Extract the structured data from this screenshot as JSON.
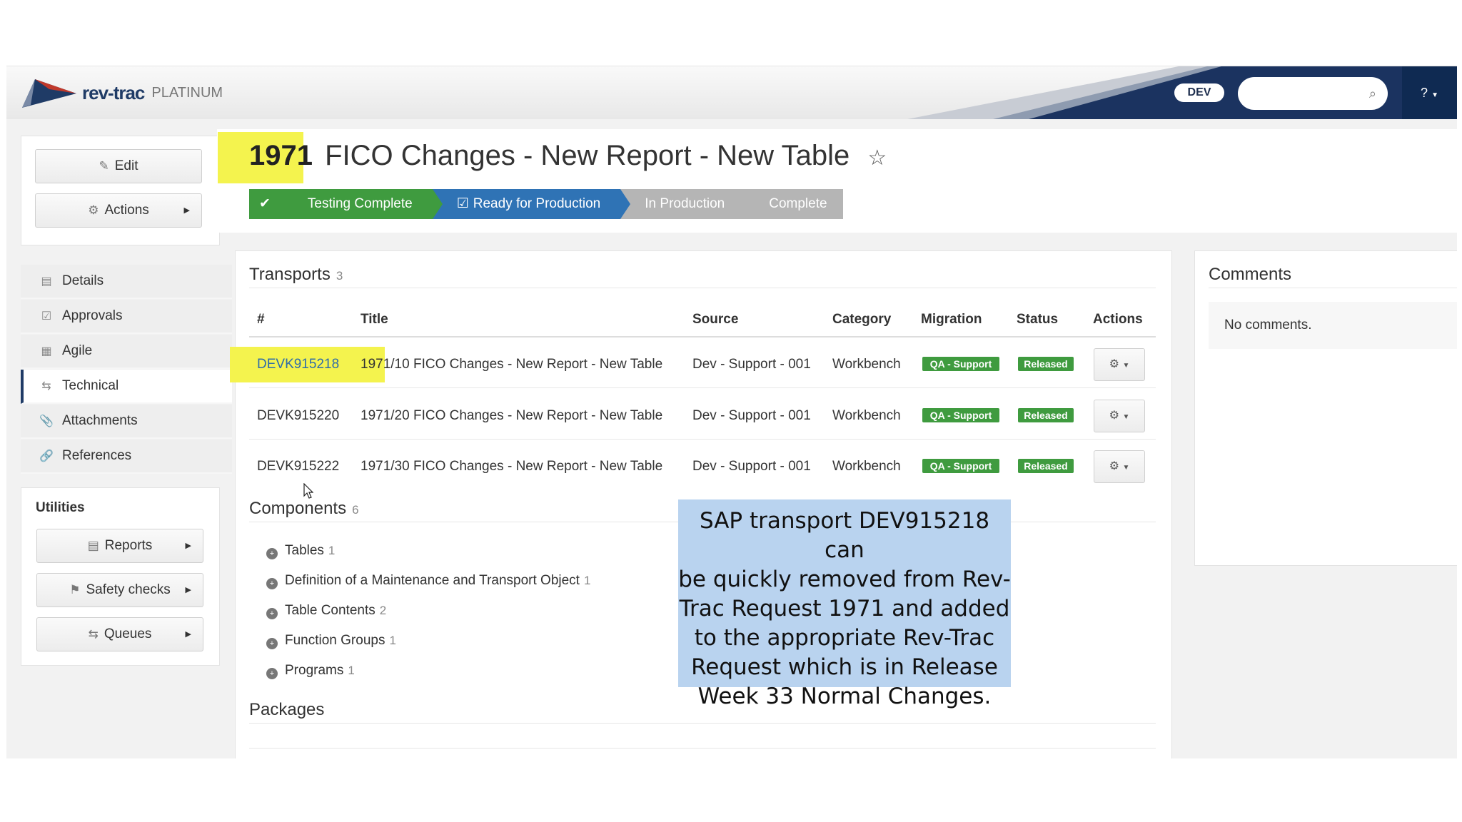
{
  "header": {
    "brand": "rev-trac",
    "tier": "PLATINUM",
    "env_badge": "DEV",
    "search_placeholder": "",
    "help_label": "?"
  },
  "left_actions": {
    "edit_label": "Edit",
    "actions_label": "Actions"
  },
  "nav": {
    "items": [
      {
        "label": "Details",
        "icon": "list-icon"
      },
      {
        "label": "Approvals",
        "icon": "check-square-icon"
      },
      {
        "label": "Agile",
        "icon": "grid-icon"
      },
      {
        "label": "Technical",
        "icon": "exchange-icon",
        "active": true
      },
      {
        "label": "Attachments",
        "icon": "paperclip-icon"
      },
      {
        "label": "References",
        "icon": "link-icon"
      }
    ]
  },
  "utilities": {
    "title": "Utilities",
    "reports_label": "Reports",
    "safety_label": "Safety checks",
    "queues_label": "Queues"
  },
  "request": {
    "number": "1971",
    "title": "FICO Changes - New Report - New Table",
    "steps": [
      {
        "label": "",
        "icon": "check-icon",
        "color": "#3f9b3f"
      },
      {
        "label": "Testing Complete",
        "color": "#3f9b3f"
      },
      {
        "label": "Ready for Production",
        "icon": "check-square-icon",
        "color": "#2f73b5"
      },
      {
        "label": "In Production",
        "color": "#b5b5b5"
      },
      {
        "label": "Complete",
        "color": "#b5b5b5"
      }
    ]
  },
  "transports": {
    "heading": "Transports",
    "count": "3",
    "columns": [
      "#",
      "Title",
      "Source",
      "Category",
      "Migration",
      "Status",
      "Actions"
    ],
    "rows": [
      {
        "id": "DEVK915218",
        "title": "1971/10 FICO Changes - New Report - New Table",
        "source": "Dev - Support - 001",
        "category": "Workbench",
        "migration": "QA - Support",
        "status": "Released"
      },
      {
        "id": "DEVK915220",
        "title": "1971/20 FICO Changes - New Report - New Table",
        "source": "Dev - Support - 001",
        "category": "Workbench",
        "migration": "QA - Support",
        "status": "Released"
      },
      {
        "id": "DEVK915222",
        "title": "1971/30 FICO Changes - New Report - New Table",
        "source": "Dev - Support - 001",
        "category": "Workbench",
        "migration": "QA - Support",
        "status": "Released"
      }
    ]
  },
  "components": {
    "heading": "Components",
    "count": "6",
    "items": [
      {
        "label": "Tables",
        "count": "1"
      },
      {
        "label": "Definition of a Maintenance and Transport Object",
        "count": "1"
      },
      {
        "label": "Table Contents",
        "count": "2"
      },
      {
        "label": "Function Groups",
        "count": "1"
      },
      {
        "label": "Programs",
        "count": "1"
      }
    ]
  },
  "packages": {
    "heading": "Packages"
  },
  "comments": {
    "heading": "Comments",
    "empty_text": "No comments."
  },
  "callout": {
    "lines": [
      "SAP transport DEV915218 can",
      "be quickly removed from Rev-",
      "Trac Request 1971 and added",
      "to the appropriate Rev-Trac",
      "Request which is in Release",
      "Week 33 Normal Changes."
    ]
  },
  "colors": {
    "navy": "#1f3b66",
    "green": "#3f9b3f",
    "blue_step": "#2f73b5",
    "grey_step": "#b5b5b5",
    "highlight": "#f4f34e",
    "callout_bg": "#b9d3ef"
  }
}
